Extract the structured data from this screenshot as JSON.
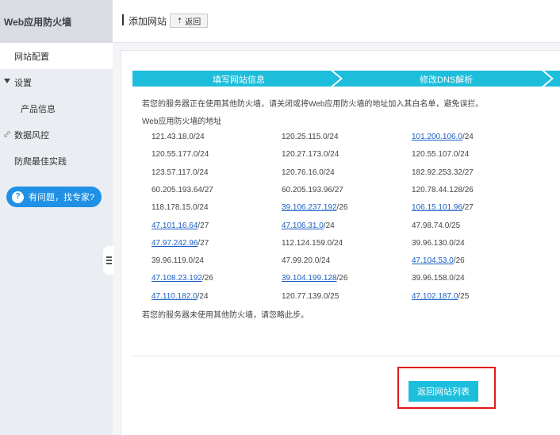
{
  "sidebar": {
    "title": "Web应用防火墙",
    "items": [
      {
        "label": "网站配置"
      },
      {
        "label": "设置"
      },
      {
        "label": "产品信息"
      },
      {
        "label": "数据风控"
      },
      {
        "label": "防爬最佳实践"
      }
    ],
    "help_label": "有问题，找专家?",
    "help_icon": "?"
  },
  "header": {
    "title": "添加网站",
    "back_label": "返回",
    "back_icon": "⇡"
  },
  "steps": [
    {
      "label": "填写网站信息"
    },
    {
      "label": "修改DNS解析"
    }
  ],
  "content": {
    "notice": "若您的服务器正在使用其他防火墙，请关闭或将Web应用防火墙的地址加入其白名单，避免误拦。",
    "address_label": "Web应用防火墙的地址",
    "footer_note": "若您的服务器未使用其他防火墙，请忽略此步。",
    "ip_rows": [
      [
        {
          "link": "",
          "rest": "121.43.18.0/24"
        },
        {
          "link": "",
          "rest": "120.25.115.0/24"
        },
        {
          "link": "101.200.106.0",
          "rest": "/24"
        }
      ],
      [
        {
          "link": "",
          "rest": "120.55.177.0/24"
        },
        {
          "link": "",
          "rest": "120.27.173.0/24"
        },
        {
          "link": "",
          "rest": "120.55.107.0/24"
        }
      ],
      [
        {
          "link": "",
          "rest": "123.57.117.0/24"
        },
        {
          "link": "",
          "rest": "120.76.16.0/24"
        },
        {
          "link": "",
          "rest": "182.92.253.32/27"
        }
      ],
      [
        {
          "link": "",
          "rest": "60.205.193.64/27"
        },
        {
          "link": "",
          "rest": "60.205.193.96/27"
        },
        {
          "link": "",
          "rest": "120.78.44.128/26"
        }
      ],
      [
        {
          "link": "",
          "rest": "118.178.15.0/24"
        },
        {
          "link": "39.106.237.192",
          "rest": "/26"
        },
        {
          "link": "106.15.101.96",
          "rest": "/27"
        }
      ],
      [
        {
          "link": "47.101.16.64",
          "rest": "/27"
        },
        {
          "link": "47.106.31.0",
          "rest": "/24"
        },
        {
          "link": "",
          "rest": "47.98.74.0/25"
        }
      ],
      [
        {
          "link": "47.97.242.96",
          "rest": "/27"
        },
        {
          "link": "",
          "rest": "112.124.159.0/24"
        },
        {
          "link": "",
          "rest": "39.96.130.0/24"
        }
      ],
      [
        {
          "link": "",
          "rest": "39.96.119.0/24"
        },
        {
          "link": "",
          "rest": "47.99.20.0/24"
        },
        {
          "link": "47.104.53.0",
          "rest": "/26"
        }
      ],
      [
        {
          "link": "47.108.23.192",
          "rest": "/26"
        },
        {
          "link": "39.104.199.128",
          "rest": "/26"
        },
        {
          "link": "",
          "rest": "39.96.158.0/24"
        }
      ],
      [
        {
          "link": "47.110.182.0",
          "rest": "/24"
        },
        {
          "link": "",
          "rest": "120.77.139.0/25"
        },
        {
          "link": "47.102.187.0",
          "rest": "/25"
        }
      ]
    ]
  },
  "actions": {
    "return_list_label": "返回网站列表"
  },
  "colors": {
    "accent": "#1dbedc",
    "link": "#1a5fc4",
    "highlight_box": "#e01b1b",
    "help_button": "#1f90e6"
  }
}
